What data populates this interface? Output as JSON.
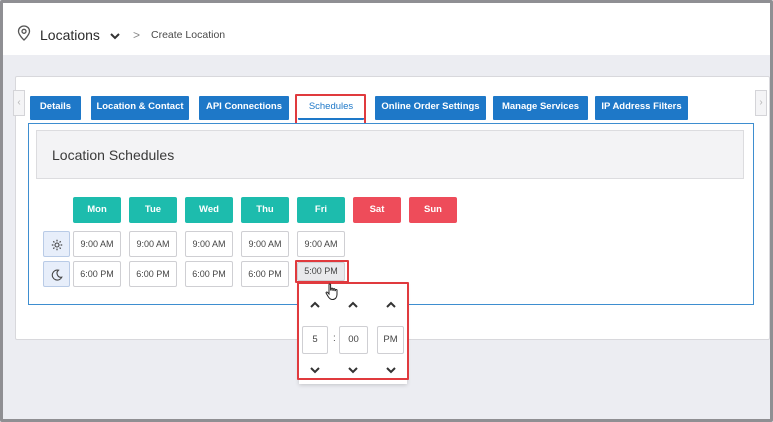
{
  "header": {
    "title": "Locations",
    "separator": ">",
    "current_page": "Create Location"
  },
  "tabs": [
    {
      "label": "Details"
    },
    {
      "label": "Location & Contact"
    },
    {
      "label": "API Connections"
    },
    {
      "label": "Schedules",
      "active": true
    },
    {
      "label": "Online Order Settings"
    },
    {
      "label": "Manage Services"
    },
    {
      "label": "IP Address Filters"
    }
  ],
  "schedules": {
    "title": "Location Schedules",
    "days": [
      {
        "label": "Mon",
        "type": "weekday"
      },
      {
        "label": "Tue",
        "type": "weekday"
      },
      {
        "label": "Wed",
        "type": "weekday"
      },
      {
        "label": "Thu",
        "type": "weekday"
      },
      {
        "label": "Fri",
        "type": "weekday"
      },
      {
        "label": "Sat",
        "type": "weekend"
      },
      {
        "label": "Sun",
        "type": "weekend"
      }
    ],
    "open_times": [
      "9:00 AM",
      "9:00 AM",
      "9:00 AM",
      "9:00 AM",
      "9:00 AM"
    ],
    "close_times": [
      "6:00 PM",
      "6:00 PM",
      "6:00 PM",
      "6:00 PM",
      "5:00 PM"
    ],
    "open_row_icon": "gear-icon",
    "close_row_icon": "moon-icon"
  },
  "time_picker": {
    "hour": "5",
    "separator": ":",
    "minute": "00",
    "period": "PM"
  },
  "colors": {
    "tab_blue": "#1e78c8",
    "weekday_teal": "#1dbcad",
    "weekend_red": "#ee4c5a",
    "highlight_red": "#e03a3e"
  }
}
